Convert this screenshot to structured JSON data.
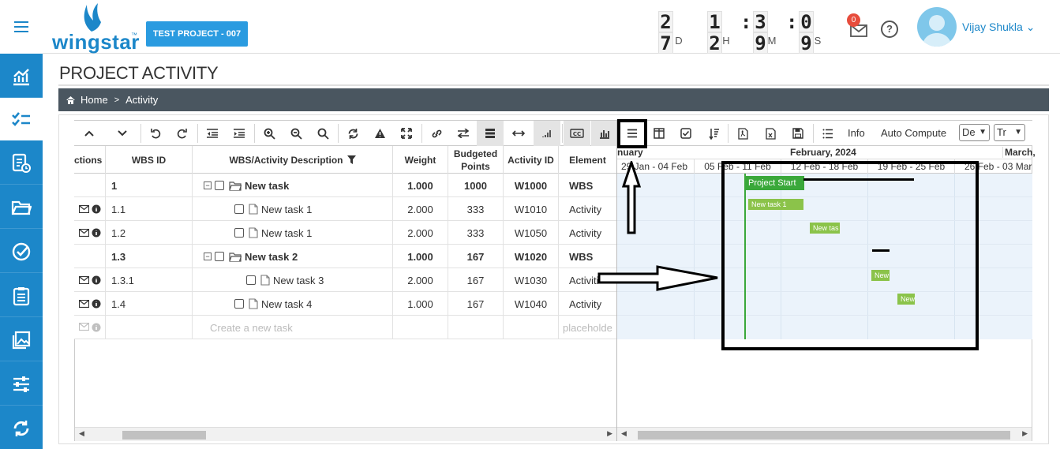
{
  "header": {
    "logo_text": "wingstar",
    "logo_tm": "™",
    "project_button": "TEST PROJECT - 007",
    "countdown": {
      "days_digits": [
        "2",
        "7"
      ],
      "hours_digits": [
        "1",
        "2"
      ],
      "minutes_digits": [
        "3",
        "9"
      ],
      "seconds_digits": [
        "0",
        "9"
      ],
      "colon": ":",
      "labels": {
        "days": "D",
        "hours": "H",
        "minutes": "M",
        "seconds": "S"
      }
    },
    "mail_badge": "0",
    "help": "?",
    "user_name": "Vijay Shukla",
    "user_caret": "⌄"
  },
  "page": {
    "title": "PROJECT ACTIVITY",
    "breadcrumb": {
      "home": "Home",
      "sep": ">",
      "current": "Activity"
    }
  },
  "toolbar": {
    "info": "Info",
    "auto_compute": "Auto Compute",
    "select1": "De",
    "select2": "Tr"
  },
  "grid": {
    "headers": {
      "actions": "ctions",
      "wbs_id": "WBS ID",
      "description": "WBS/Activity Description",
      "weight": "Weight",
      "budgeted_points": "Budgeted Points",
      "activity_id": "Activity ID",
      "element": "Element"
    },
    "rows": [
      {
        "wbs": "1",
        "desc": "New task",
        "weight": "1.000",
        "points": "1000",
        "act_id": "W1000",
        "element": "WBS"
      },
      {
        "wbs": "1.1",
        "desc": "New task 1",
        "weight": "2.000",
        "points": "333",
        "act_id": "W1010",
        "element": "Activity"
      },
      {
        "wbs": "1.2",
        "desc": "New task 1",
        "weight": "2.000",
        "points": "333",
        "act_id": "W1050",
        "element": "Activity"
      },
      {
        "wbs": "1.3",
        "desc": "New task 2",
        "weight": "1.000",
        "points": "167",
        "act_id": "W1020",
        "element": "WBS"
      },
      {
        "wbs": "1.3.1",
        "desc": "New task 3",
        "weight": "2.000",
        "points": "167",
        "act_id": "W1030",
        "element": "Activiti"
      },
      {
        "wbs": "1.4",
        "desc": "New task 4",
        "weight": "1.000",
        "points": "167",
        "act_id": "W1040",
        "element": "Activity"
      }
    ],
    "new_row": {
      "desc": "Create a new task",
      "element": "placeholde"
    }
  },
  "gantt": {
    "months": [
      "nuary",
      "February, 2024",
      "March,"
    ],
    "weeks": [
      "29 Jan - 04 Feb",
      "05 Feb - 11 Feb",
      "12 Feb - 18 Feb",
      "19 Feb - 25 Feb",
      "26 Feb - 03 Mar"
    ],
    "bars": [
      "Project Start",
      "New task 1",
      "New tas",
      "New",
      "New"
    ]
  }
}
